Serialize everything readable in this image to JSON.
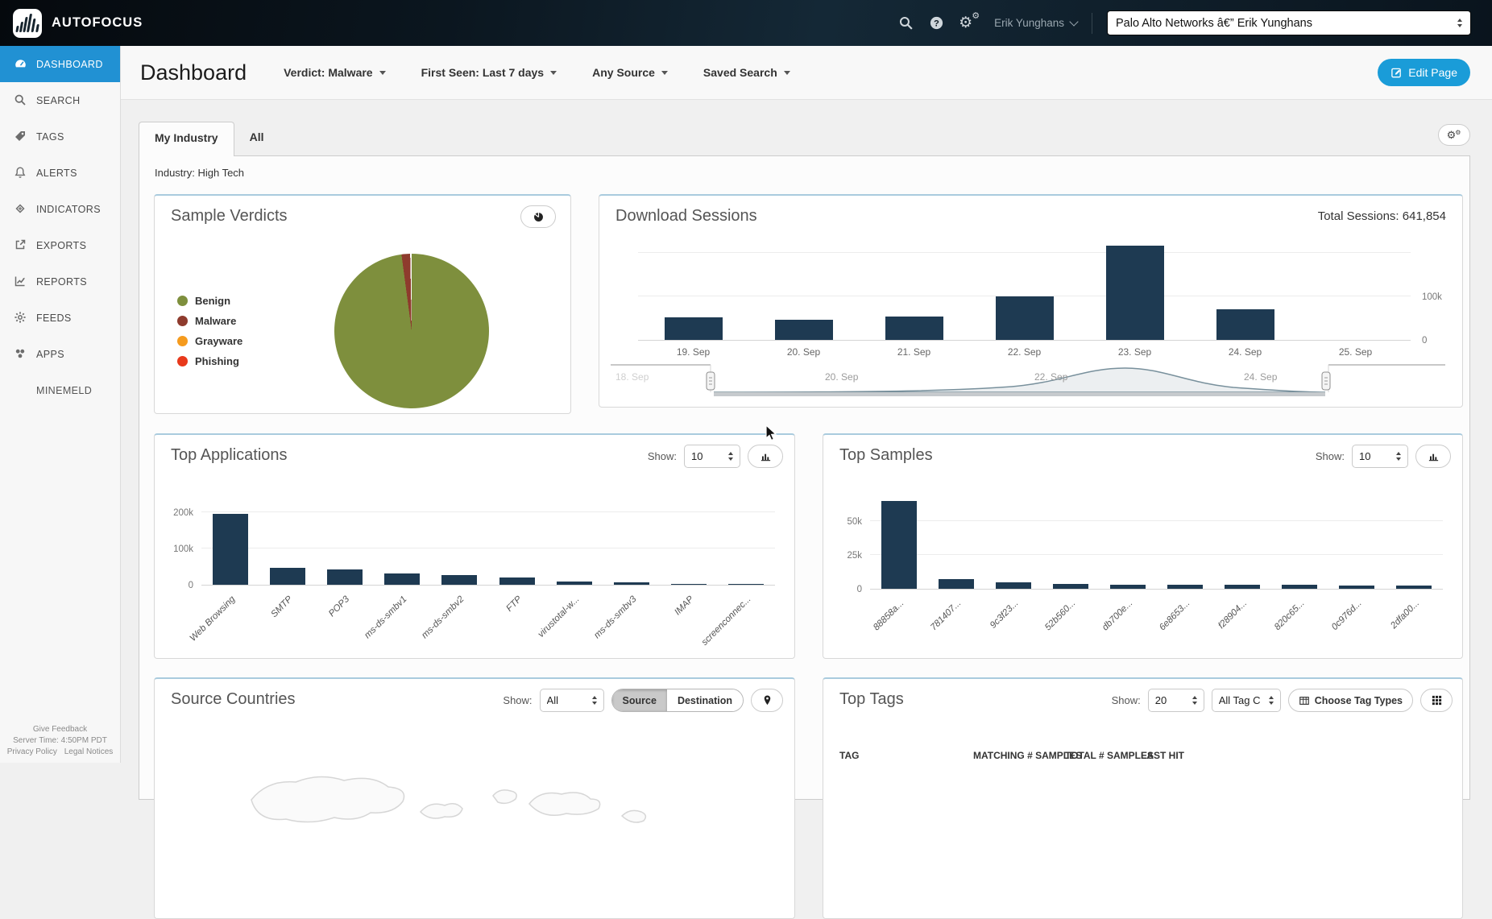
{
  "navbar": {
    "brand": "AUTOFOCUS",
    "user": "Erik Yunghans",
    "account_select": "Palo Alto Networks â€” Erik Yunghans"
  },
  "sidebar": {
    "items": [
      {
        "label": "DASHBOARD",
        "icon": "gauge",
        "active": true
      },
      {
        "label": "SEARCH",
        "icon": "search",
        "active": false
      },
      {
        "label": "TAGS",
        "icon": "tag",
        "active": false
      },
      {
        "label": "ALERTS",
        "icon": "bell",
        "active": false
      },
      {
        "label": "INDICATORS",
        "icon": "diamond",
        "active": false
      },
      {
        "label": "EXPORTS",
        "icon": "export",
        "active": false
      },
      {
        "label": "REPORTS",
        "icon": "report",
        "active": false
      },
      {
        "label": "FEEDS",
        "icon": "gear",
        "active": false
      },
      {
        "label": "APPS",
        "icon": "apps",
        "active": false
      },
      {
        "label": "MINEMELD",
        "icon": "",
        "active": false
      }
    ],
    "footer": {
      "feedback": "Give Feedback",
      "server_time": "Server Time: 4:50PM PDT",
      "privacy": "Privacy Policy",
      "legal": "Legal Notices"
    }
  },
  "header": {
    "title": "Dashboard",
    "filters": [
      "Verdict: Malware",
      "First Seen: Last 7 days",
      "Any Source",
      "Saved Search"
    ],
    "edit_button": "Edit Page"
  },
  "tabs": {
    "active": "My Industry",
    "other": "All"
  },
  "industry_label": "Industry: High Tech",
  "panels": {
    "sample_verdicts": {
      "title": "Sample Verdicts"
    },
    "download_sessions": {
      "title": "Download Sessions",
      "total_label": "Total Sessions: 641,854"
    },
    "top_applications": {
      "title": "Top Applications",
      "show_label": "Show:",
      "show_value": "10"
    },
    "top_samples": {
      "title": "Top Samples",
      "show_label": "Show:",
      "show_value": "10"
    },
    "source_countries": {
      "title": "Source Countries",
      "show_label": "Show:",
      "show_value": "All",
      "segments": [
        "Source",
        "Destination"
      ],
      "active_segment": "Source"
    },
    "top_tags": {
      "title": "Top Tags",
      "show_label": "Show:",
      "show_value": "20",
      "tag_type_value": "All Tag C",
      "choose_button": "Choose Tag Types",
      "table_headers": [
        "TAG",
        "MATCHING # SAMPLES",
        "TOTAL # SAMPLES",
        "LAST HIT"
      ]
    }
  },
  "chart_data": {
    "sample_verdicts": {
      "type": "pie",
      "title": "Sample Verdicts",
      "slices": [
        {
          "label": "Benign",
          "percent": 97.9,
          "color": "#7E8F3D"
        },
        {
          "label": "Malware",
          "percent": 1.8,
          "color": "#8E3B2D"
        },
        {
          "label": "Grayware",
          "percent": 0.2,
          "color": "#F59B1E"
        },
        {
          "label": "Phishing",
          "percent": 0.1,
          "color": "#E8391B"
        }
      ]
    },
    "download_sessions": {
      "type": "bar",
      "title": "Download Sessions",
      "total_sessions": 641854,
      "categories": [
        "19. Sep",
        "20. Sep",
        "21. Sep",
        "22. Sep",
        "23. Sep",
        "24. Sep",
        "25. Sep"
      ],
      "values": [
        52000,
        47000,
        54000,
        101000,
        218000,
        70000,
        0
      ],
      "ylabel": "",
      "xlabel": "",
      "ylim": [
        0,
        260000
      ],
      "yticks": [
        {
          "v": 0,
          "label": "0"
        },
        {
          "v": 100000,
          "label": "100k"
        },
        {
          "v": 200000,
          "label": ""
        }
      ],
      "slider_labels": [
        "18. Sep",
        "20. Sep",
        "22. Sep",
        "24. Sep"
      ]
    },
    "top_applications": {
      "type": "bar",
      "title": "Top Applications",
      "categories": [
        "Web Browsing",
        "SMTP",
        "POP3",
        "ms-ds-smbv1",
        "ms-ds-smbv2",
        "FTP",
        "virustotal-w...",
        "ms-ds-smbv3",
        "IMAP",
        "screenconnec..."
      ],
      "values": [
        195000,
        46000,
        43000,
        30000,
        27000,
        21000,
        9000,
        7000,
        1500,
        800
      ],
      "ylabel": "",
      "xlabel": "",
      "ylim": [
        0,
        210000
      ],
      "yticks": [
        {
          "v": 0,
          "label": "0"
        },
        {
          "v": 100000,
          "label": "100k"
        },
        {
          "v": 200000,
          "label": "200k"
        }
      ]
    },
    "top_samples": {
      "type": "bar",
      "title": "Top Samples",
      "categories": [
        "88858a...",
        "781407...",
        "9c3f23...",
        "52b560...",
        "db700e...",
        "6e8653...",
        "f28904...",
        "820c65...",
        "0c976d...",
        "2dfa00..."
      ],
      "values": [
        65000,
        7000,
        4500,
        3800,
        2900,
        2900,
        2900,
        2900,
        2200,
        2200
      ],
      "ylabel": "",
      "xlabel": "",
      "ylim": [
        0,
        68000
      ],
      "yticks": [
        {
          "v": 0,
          "label": "0"
        },
        {
          "v": 25000,
          "label": "25k"
        },
        {
          "v": 50000,
          "label": "50k"
        }
      ]
    }
  }
}
